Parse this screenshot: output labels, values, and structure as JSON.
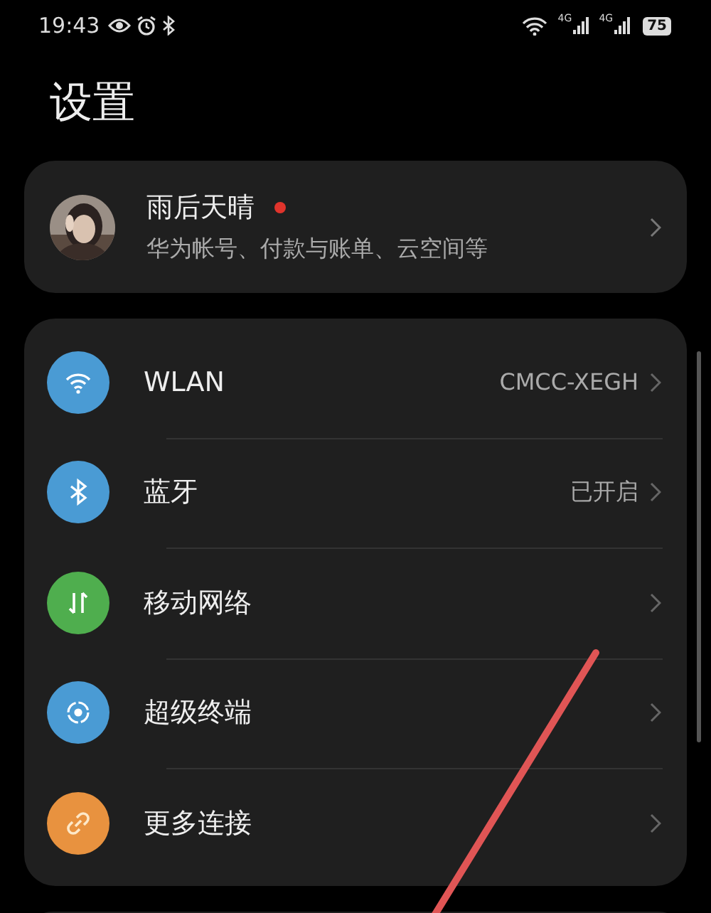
{
  "status_bar": {
    "time": "19:43",
    "network_labels": [
      "4G",
      "4G"
    ],
    "battery": "75"
  },
  "title": "设置",
  "account": {
    "name": "雨后天晴",
    "notification_dot": true,
    "subtitle": "华为帐号、付款与账单、云空间等"
  },
  "connections": [
    {
      "kind": "wifi",
      "color": "#4a9bd4",
      "label": "WLAN",
      "value": "CMCC-XEGH"
    },
    {
      "kind": "bluetooth",
      "color": "#4a9bd4",
      "label": "蓝牙",
      "value": "已开启"
    },
    {
      "kind": "mobile",
      "color": "#4fae4e",
      "label": "移动网络"
    },
    {
      "kind": "superdevice",
      "color": "#4a9bd4",
      "label": "超级终端"
    },
    {
      "kind": "link",
      "color": "#e8923f",
      "label": "更多连接"
    }
  ]
}
